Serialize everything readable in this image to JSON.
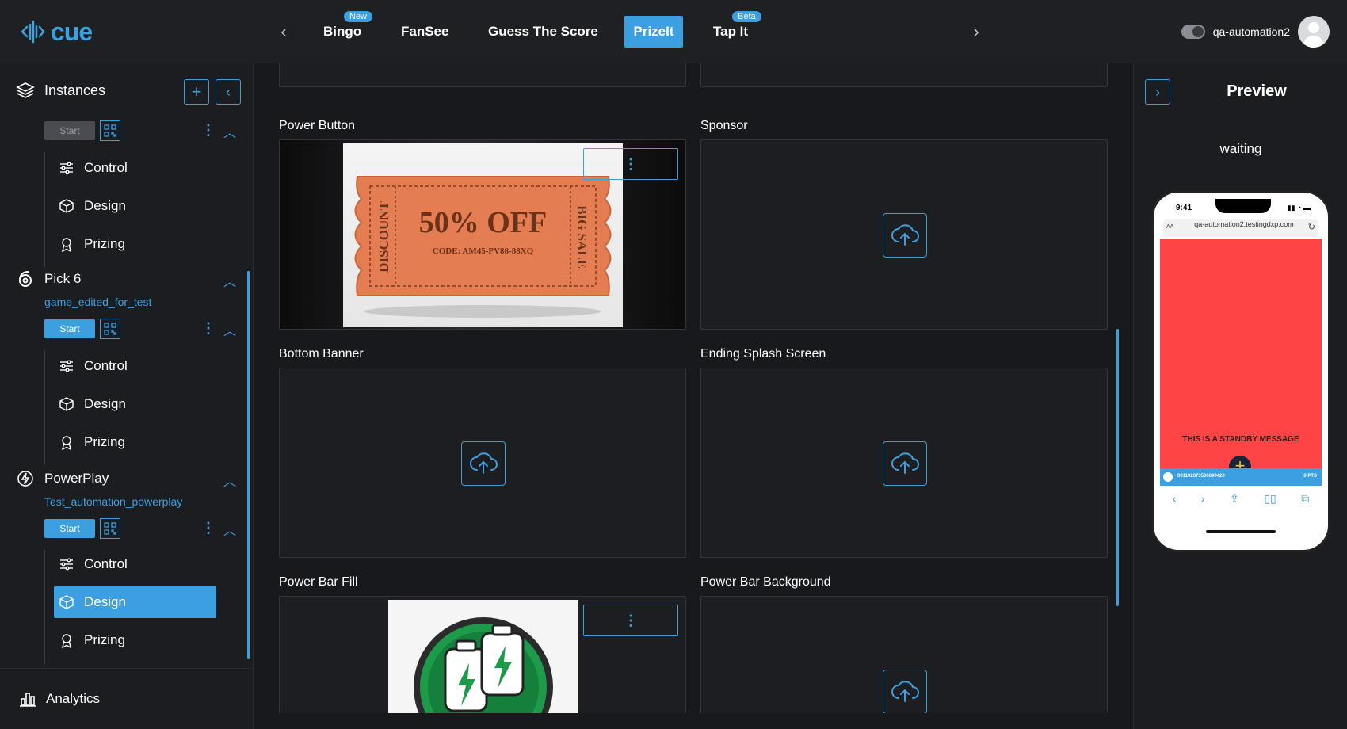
{
  "app": {
    "logo_text": "cue"
  },
  "nav": {
    "tabs": [
      {
        "label": "Bingo",
        "badge": "New"
      },
      {
        "label": "FanSee"
      },
      {
        "label": "Guess The Score"
      },
      {
        "label": "PrizeIt",
        "active": true
      },
      {
        "label": "Tap It",
        "badge": "Beta"
      }
    ]
  },
  "user": {
    "name": "qa-automation2"
  },
  "sidebar": {
    "title": "Instances",
    "instance0": {
      "start_label": "Start",
      "items": [
        "Control",
        "Design",
        "Prizing"
      ]
    },
    "pick6": {
      "name": "Pick 6",
      "subtitle": "game_edited_for_test",
      "start_label": "Start",
      "items": [
        "Control",
        "Design",
        "Prizing"
      ]
    },
    "powerplay": {
      "name": "PowerPlay",
      "subtitle": "Test_automation_powerplay",
      "start_label": "Start",
      "items": [
        "Control",
        "Design",
        "Prizing"
      ],
      "active_item": "Design"
    },
    "analytics": "Analytics"
  },
  "main": {
    "slots": [
      {
        "label": "Power Button"
      },
      {
        "label": "Sponsor"
      },
      {
        "label": "Bottom Banner"
      },
      {
        "label": "Ending Splash Screen"
      },
      {
        "label": "Power Bar Fill"
      },
      {
        "label": "Power Bar Background"
      }
    ],
    "coupon": {
      "side_left": "DISCOUNT",
      "headline": "50% OFF",
      "code": "CODE: AM45-PV88-88XQ",
      "side_right": "BIG SALE"
    }
  },
  "preview": {
    "title": "Preview",
    "status": "waiting",
    "phone": {
      "time": "9:41",
      "url": "qa-automation2.testingdxp.com",
      "aa": "AA",
      "message": "THIS IS A STANDBY MESSAGE",
      "footer_id": "001102673506090420",
      "footer_pts": "0 PTS"
    }
  },
  "colors": {
    "accent": "#3b9fe0",
    "phone_screen": "#fe4444"
  }
}
